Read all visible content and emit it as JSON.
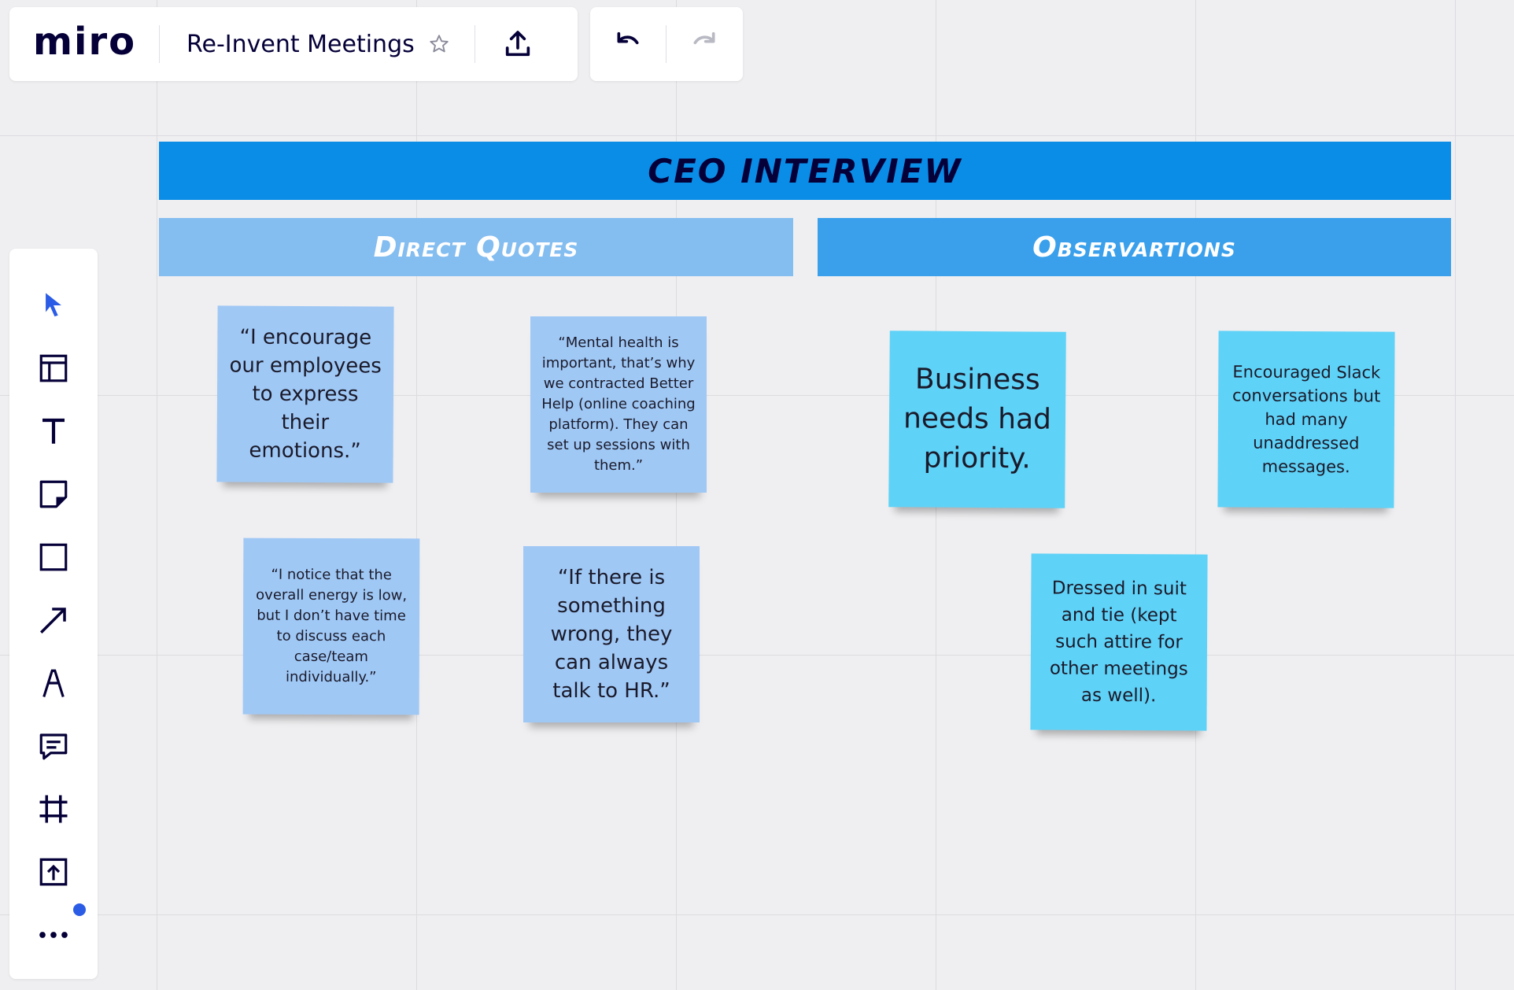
{
  "app": {
    "logo_text": "miro",
    "board_title": "Re-Invent Meetings"
  },
  "topbar": {
    "icons": [
      "star-icon",
      "upload-icon"
    ],
    "undo_icons": [
      "undo-icon",
      "redo-icon"
    ]
  },
  "toolbar": {
    "tools": [
      "cursor-icon",
      "templates-icon",
      "text-icon",
      "sticky-note-icon",
      "shape-icon",
      "arrow-icon",
      "pen-icon",
      "comment-icon",
      "frame-icon",
      "upload-icon",
      "more-icon"
    ],
    "accent_color": "#2b5ce6"
  },
  "board": {
    "main_header": "CEO INTERVIEW",
    "columns": [
      {
        "title": "Direct Quotes",
        "color": "#84bdf0"
      },
      {
        "title": "Observartions",
        "color": "#3aa0ec"
      }
    ],
    "quotes": [
      "“I encourage our employees to express their emotions.”",
      "“Mental health is important, that’s why we contracted Better Help (online coaching platform). They can set up sessions with them.”",
      "“I notice that the overall energy is low, but I don’t have time to discuss each case/team individually.”",
      "“If there is something wrong, they can always talk to HR.”"
    ],
    "observations": [
      "Business needs had priority.",
      "Encouraged Slack conversations but had many unaddressed messages.",
      "Dressed in suit and tie (kept such attire for other meetings as well)."
    ],
    "colors": {
      "header": "#0a8de6",
      "quote_sticky": "#a0c8f5",
      "observation_sticky": "#5fd2f7"
    }
  }
}
